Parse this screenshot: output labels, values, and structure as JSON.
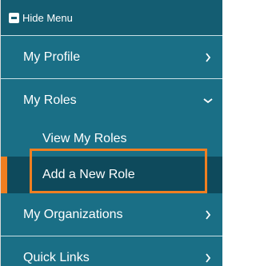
{
  "hide_menu": {
    "label": "Hide Menu"
  },
  "items": {
    "profile": {
      "label": "My Profile"
    },
    "roles": {
      "label": "My Roles"
    },
    "organizations": {
      "label": "My Organizations"
    },
    "quick_links": {
      "label": "Quick Links"
    }
  },
  "sub_items": {
    "view_roles": {
      "label": "View My Roles"
    },
    "add_role": {
      "label": "Add a New Role"
    }
  },
  "colors": {
    "menu_bg": "#1a6f86",
    "header_bg": "#145d72",
    "active_bg": "#0e4a5c",
    "accent": "#f07f21"
  },
  "icons": {
    "hide_menu": "minus-square-icon",
    "collapsed": "chevron-right-icon",
    "expanded": "chevron-down-icon"
  }
}
